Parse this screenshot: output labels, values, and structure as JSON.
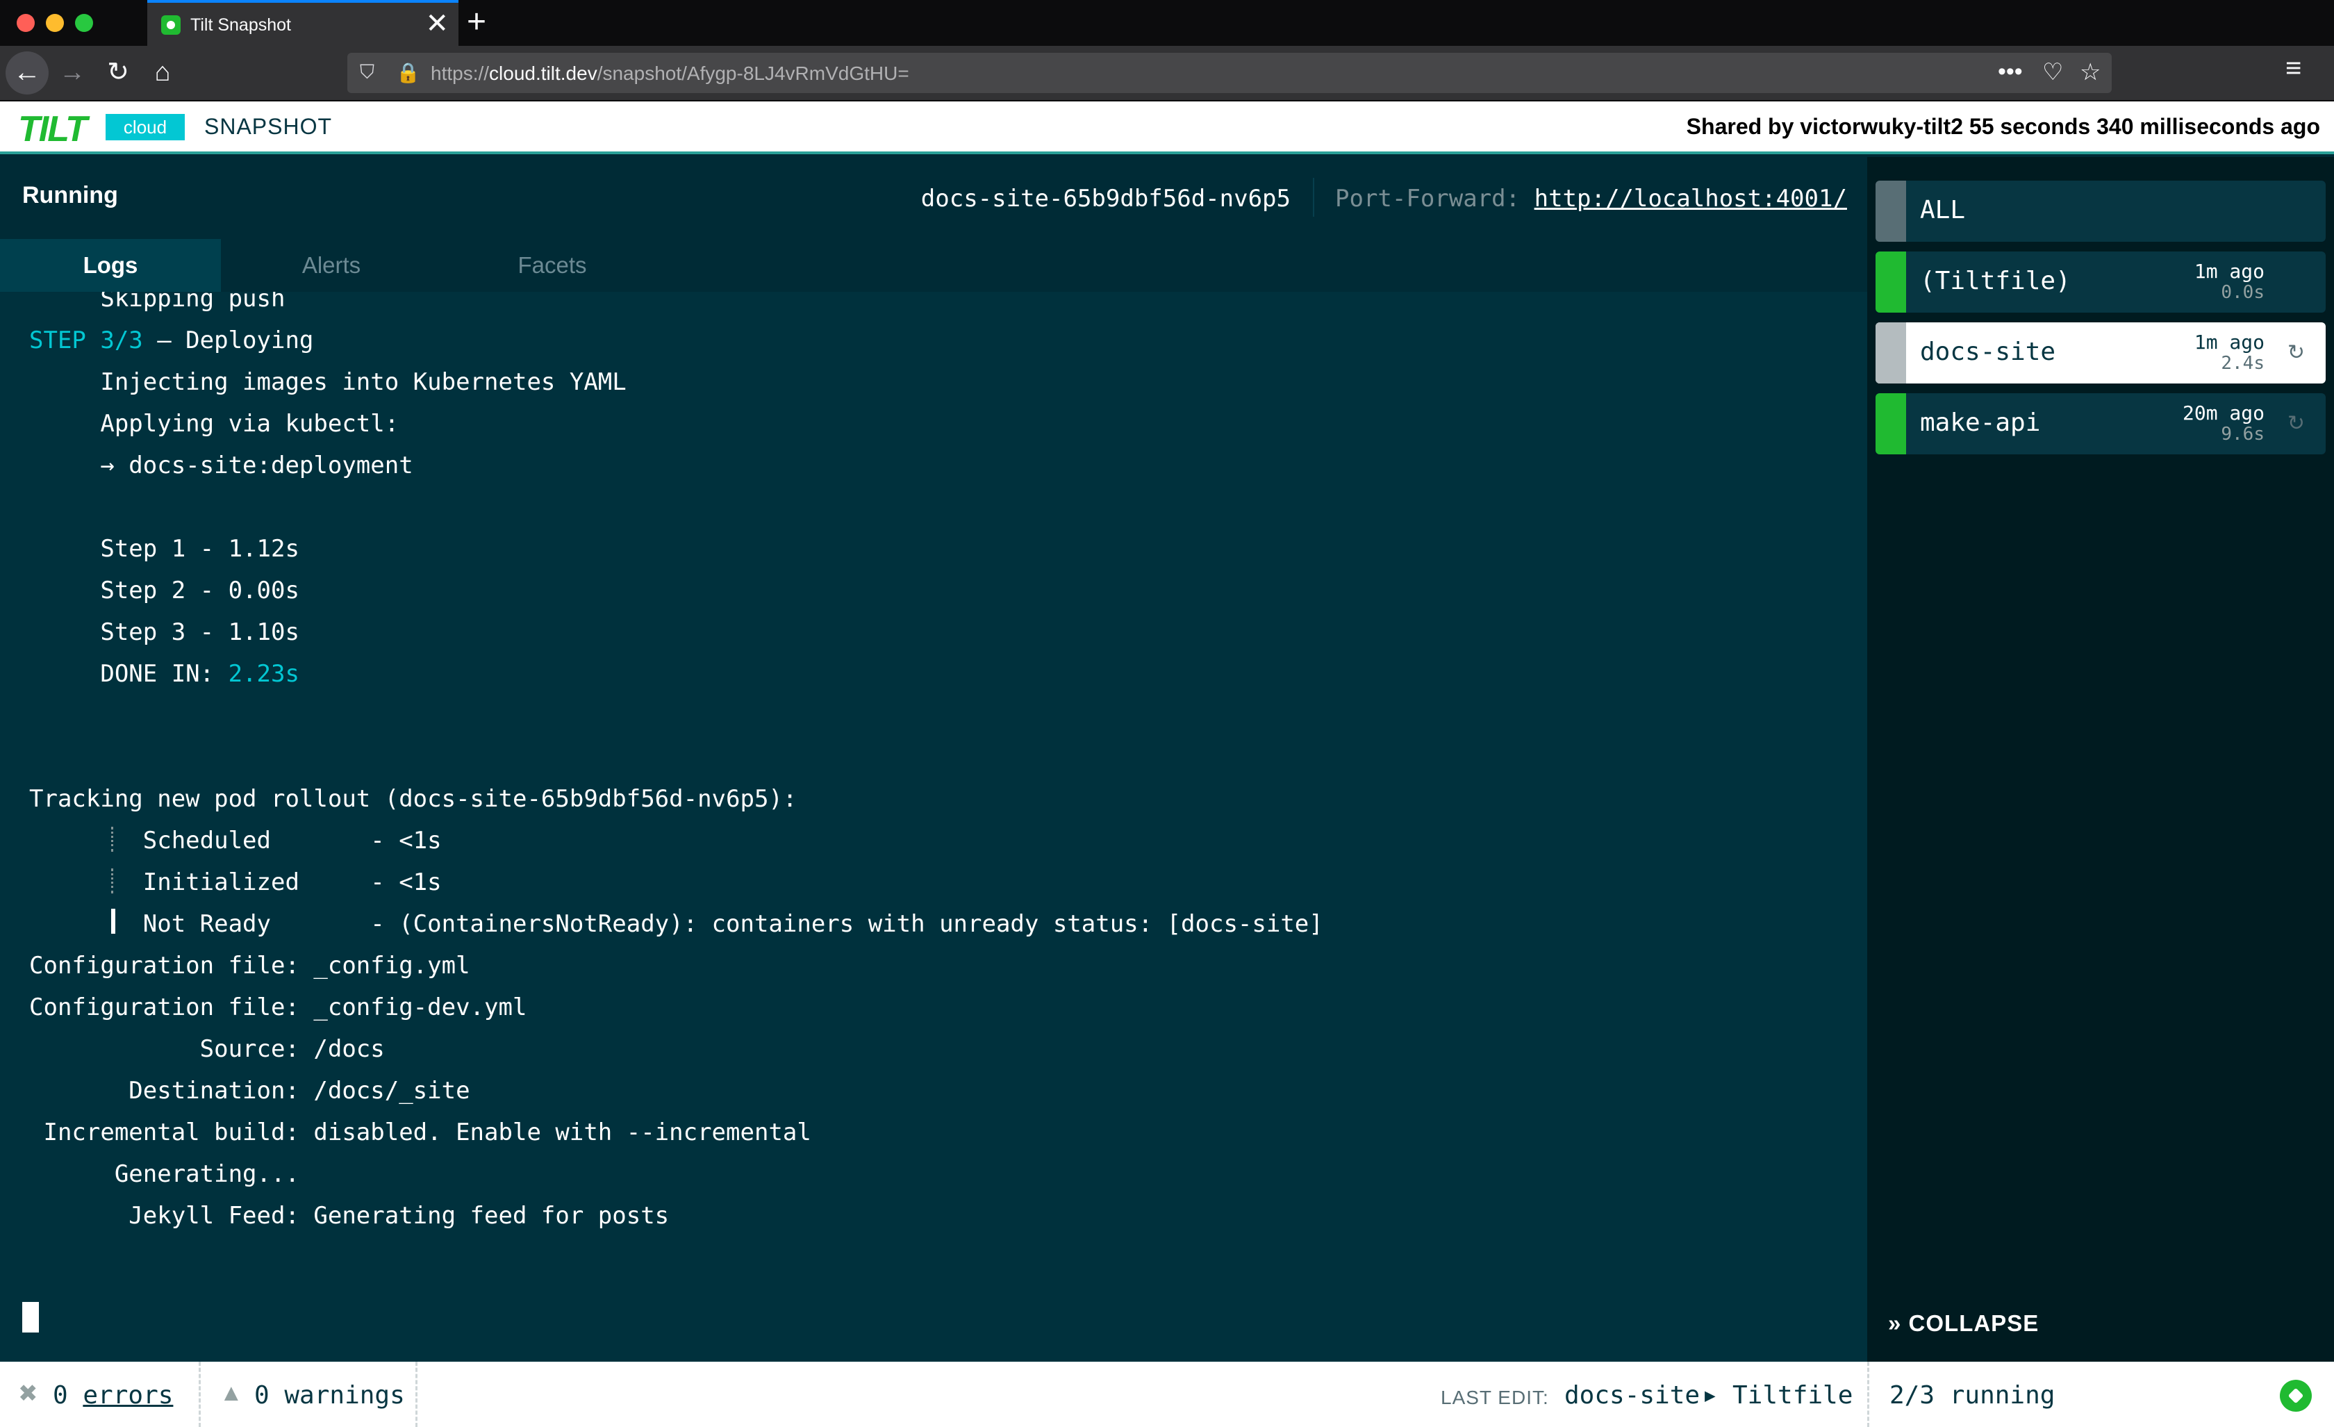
{
  "browser": {
    "tab_title": "Tilt Snapshot",
    "tab_close": "✕",
    "new_tab": "+",
    "url_protocol": "https://",
    "url_host_prefix": "cloud.",
    "url_host": "tilt.dev",
    "url_path": "/snapshot/Afygp-8LJ4vRmVdGtHU=",
    "icons": [
      "back-arrow-icon",
      "forward-arrow-icon",
      "reload-icon",
      "home-icon",
      "shield-icon",
      "lock-icon",
      "more-icon",
      "pocket-icon",
      "star-icon",
      "hamburger-menu-icon"
    ]
  },
  "header": {
    "logo_text": "TILT",
    "cloud_badge": "cloud",
    "snapshot_label": "SNAPSHOT",
    "shared_by": "Shared by victorwuky-tilt2 55 seconds 340 milliseconds ago"
  },
  "main": {
    "status": "Running",
    "pod_name": "docs-site-65b9dbf56d-nv6p5",
    "port_forward_label": "Port-Forward:",
    "port_forward_url": "http://localhost:4001/",
    "tabs": [
      {
        "label": "Logs",
        "active": true
      },
      {
        "label": "Alerts",
        "active": false
      },
      {
        "label": "Facets",
        "active": false
      }
    ]
  },
  "logs": {
    "partial_top": "     Skipping push",
    "step_prefix": "STEP 3/3",
    "step_suffix": " — Deploying",
    "lines_a": [
      "     Injecting images into Kubernetes YAML",
      "     Applying via kubectl:",
      "     → docs-site:deployment",
      "",
      "     Step 1 - 1.12s",
      "     Step 2 - 0.00s",
      "     Step 3 - 1.10s"
    ],
    "done_prefix": "     DONE IN: ",
    "done_value": "2.23s",
    "tracking": "Tracking new pod rollout (docs-site-65b9dbf56d-nv6p5):",
    "pod_stages": [
      "        Scheduled       - <1s",
      "        Initialized     - <1s",
      "        Not Ready       - (ContainersNotReady): containers with unready status: [docs-site]"
    ],
    "lines_b": [
      "Configuration file: _config.yml",
      "Configuration file: _config-dev.yml",
      "            Source: /docs",
      "       Destination: /docs/_site",
      " Incremental build: disabled. Enable with --incremental",
      "      Generating...",
      "       Jekyll Feed: Generating feed for posts"
    ]
  },
  "sidebar": {
    "items": [
      {
        "name": "ALL",
        "ago": "",
        "duration": "",
        "color": "#586e75",
        "selected": false
      },
      {
        "name": "(Tiltfile)",
        "ago": "1m ago",
        "duration": "0.0s",
        "color": "#20ba31",
        "selected": false
      },
      {
        "name": "docs-site",
        "ago": "1m ago",
        "duration": "2.4s",
        "color": "#b4bcbf",
        "selected": true
      },
      {
        "name": "make-api",
        "ago": "20m ago",
        "duration": "9.6s",
        "color": "#20ba31",
        "selected": false
      }
    ],
    "collapse_label": "COLLAPSE"
  },
  "statusbar": {
    "errors_count": "0",
    "errors_label": "errors",
    "warnings_count": "0",
    "warnings_label": "warnings",
    "last_edit_label": "LAST EDIT:",
    "last_edit_resource": "docs-site",
    "last_edit_file": "Tiltfile",
    "running_count": "2/3",
    "running_label": "running"
  },
  "colors": {
    "accent_green": "#20ba31",
    "accent_cyan": "#03c7d3",
    "background": "#002b36"
  }
}
